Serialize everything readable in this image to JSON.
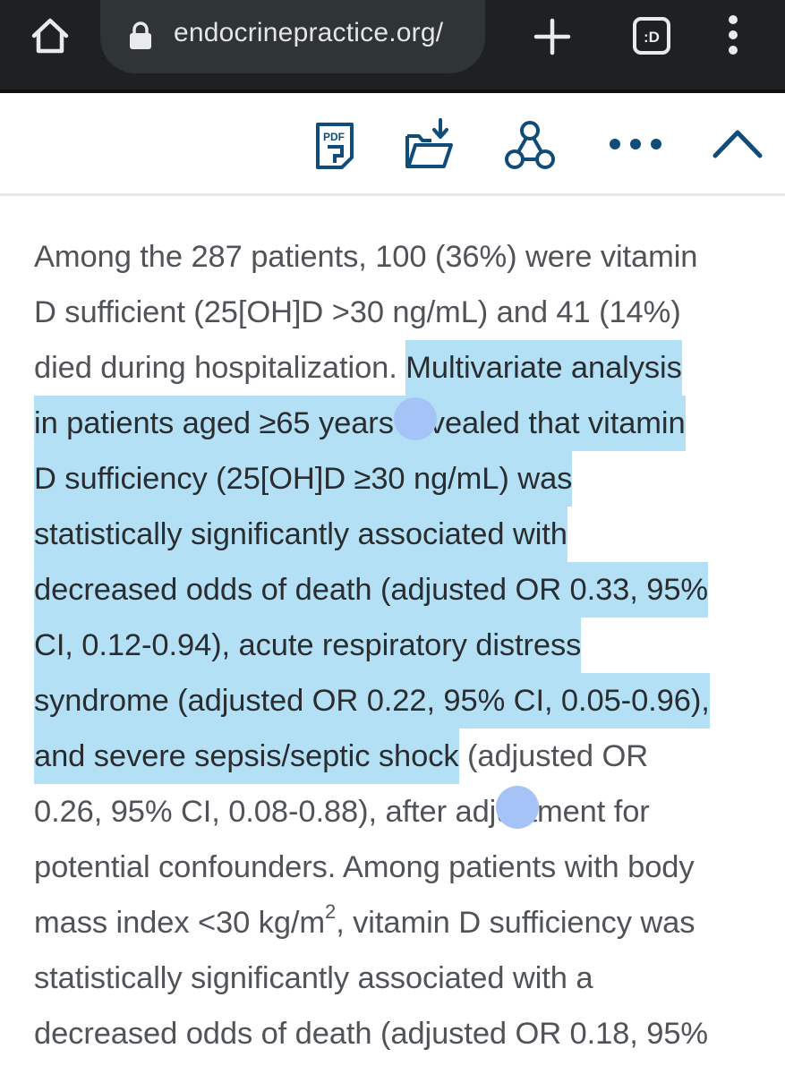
{
  "browser": {
    "url": "endocrinepractice.org/",
    "icons": [
      "home-icon",
      "lock-icon",
      "new-tab-icon",
      "tab-switcher-icon",
      "overflow-menu-icon"
    ],
    "tab_label": ":D"
  },
  "toolbar": {
    "pdf_label": "PDF",
    "icons": [
      "pdf-icon",
      "download-folder-icon",
      "share-icon",
      "more-icon",
      "collapse-up-icon"
    ]
  },
  "colors": {
    "chrome_bg": "#1e2124",
    "urlbar_bg": "#2f3437",
    "accent": "#0f4c7a",
    "highlight": "#b4e0f6",
    "handle": "#a6c3f8",
    "text": "#505357"
  },
  "article": {
    "l1": "Among the 287 patients, 100 (36%) were vitamin",
    "l2": "D sufficient (25[OH]D >30 ng/mL) and 41 (14%)",
    "l3_plain": "died during hospitalization. ",
    "l3_hl": "Multivariate analysis",
    "l4": "in patients aged ≥65 years revealed that vitamin",
    "l5": "D sufficiency (25[OH]D ≥30 ng/mL) was",
    "l6": "statistically significantly associated with",
    "l7": "decreased odds of death (adjusted OR 0.33, 95%",
    "l8": "CI, 0.12-0.94), acute respiratory distress",
    "l9": "syndrome (adjusted OR 0.22, 95% CI, 0.05-0.96),",
    "l10_hl": "and severe sepsis/septic shock",
    "l10_plain": " (adjusted OR",
    "l11": "0.26, 95% CI, 0.08-0.88), after adjustment for",
    "l12": "potential confounders. Among patients with body",
    "l13_a": "mass index <30 kg/m",
    "l13_sup": "2",
    "l13_b": ", vitamin D sufficiency was",
    "l14": "statistically significantly associated with a",
    "l15": "decreased odds of death (adjusted OR 0.18, 95%"
  }
}
